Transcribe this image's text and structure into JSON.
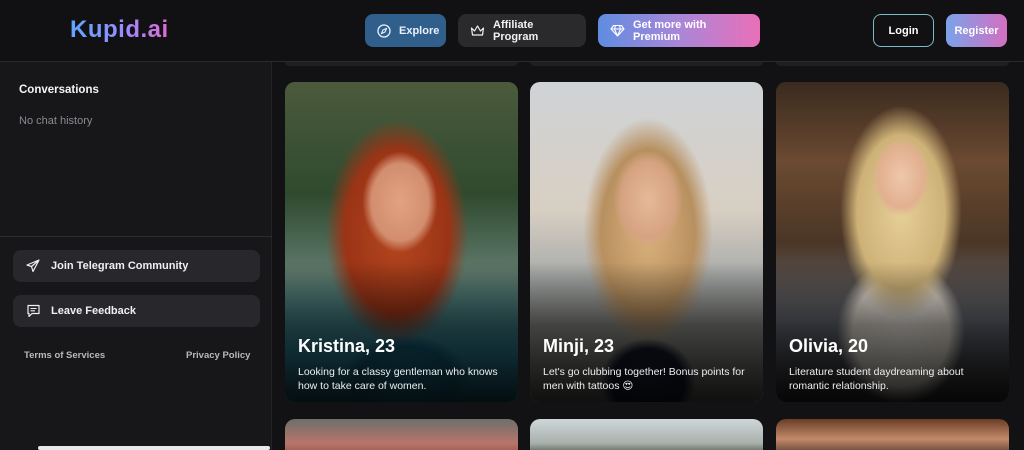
{
  "header": {
    "logo": "Kupid.ai",
    "nav": {
      "explore": "Explore",
      "affiliate": "Affiliate Program",
      "premium": "Get more with Premium"
    },
    "auth": {
      "login": "Login",
      "register": "Register"
    }
  },
  "sidebar": {
    "conversations_title": "Conversations",
    "empty_state": "No chat history",
    "telegram_label": "Join Telegram Community",
    "feedback_label": "Leave Feedback",
    "terms_label": "Terms of Services",
    "privacy_label": "Privacy Policy"
  },
  "cards": [
    {
      "name": "Kristina, 23",
      "description": "Looking for a classy gentleman who knows how to take care of women."
    },
    {
      "name": "Minji, 23",
      "description": "Let's go clubbing together! Bonus points for men with tattoos 😍"
    },
    {
      "name": "Olivia, 20",
      "description": "Literature student daydreaming about romantic relationship."
    }
  ],
  "icons": {
    "explore": "compass-icon",
    "affiliate": "crown-icon",
    "premium": "diamond-icon",
    "telegram": "send-icon",
    "feedback": "message-icon"
  },
  "colors": {
    "background": "#121214",
    "sidebar": "#17171a",
    "explore_button": "#2f5f8a",
    "accent_blue": "#5ea6ff",
    "accent_pink": "#e06bd4"
  }
}
